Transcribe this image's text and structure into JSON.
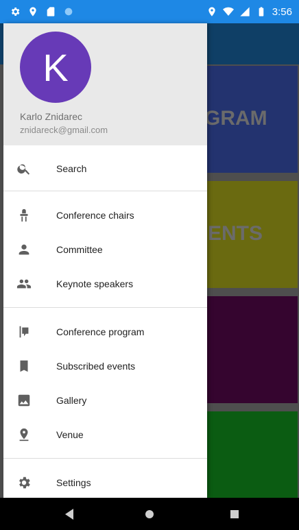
{
  "status_bar": {
    "time": "3:56",
    "left_icons": [
      "gear-icon",
      "location-icon",
      "sd-card-icon",
      "circle-icon"
    ],
    "right_icons": [
      "location-icon",
      "wifi-icon",
      "signal-icon",
      "battery-icon"
    ]
  },
  "background_tiles": [
    {
      "label": "GRAM",
      "color": "#23336f"
    },
    {
      "label": "ENTS",
      "color": "#6a6a10"
    },
    {
      "label": "",
      "color": "#35052f"
    },
    {
      "label": "",
      "color": "#0b5c12"
    }
  ],
  "drawer": {
    "avatar_letter": "K",
    "avatar_color": "#673ab7",
    "user_name": "Karlo Znidarec",
    "user_email": "znidareck@gmail.com",
    "items": [
      {
        "label": "Search",
        "icon": "search-icon"
      },
      {
        "label": "Conference chairs",
        "icon": "chair-icon"
      },
      {
        "label": "Committee",
        "icon": "person-icon"
      },
      {
        "label": "Keynote speakers",
        "icon": "people-icon"
      },
      {
        "label": "Conference program",
        "icon": "program-icon"
      },
      {
        "label": "Subscribed events",
        "icon": "bookmark-icon"
      },
      {
        "label": "Gallery",
        "icon": "image-icon"
      },
      {
        "label": "Venue",
        "icon": "place-icon"
      },
      {
        "label": "Settings",
        "icon": "settings-icon"
      }
    ]
  },
  "nav_bar": {
    "buttons": [
      "back-icon",
      "home-icon",
      "recents-icon"
    ]
  }
}
